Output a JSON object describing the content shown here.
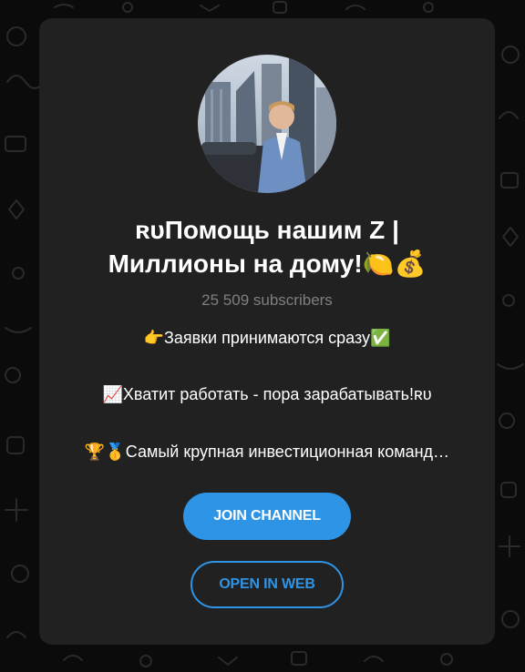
{
  "channel": {
    "title": "ʀᴜПомощь нашим Z | Миллионы на дому!🍋💰",
    "subscribers": "25 509 subscribers",
    "description_lines": [
      "👉Заявки принимаются сразу✅",
      "📈Хватит работать - пора зарабатывать!ʀᴜ",
      "🏆🥇Самый крупная инвестиционная команд…"
    ]
  },
  "actions": {
    "join_label": "JOIN CHANNEL",
    "web_label": "OPEN IN WEB"
  },
  "colors": {
    "background": "#0b0b0b",
    "card": "#212121",
    "accent": "#2e94e6",
    "muted_text": "#7f7f7f"
  }
}
